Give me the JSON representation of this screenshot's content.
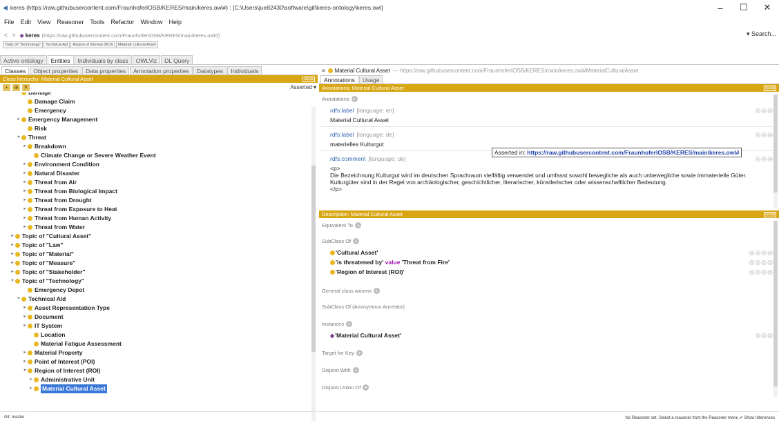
{
  "window": {
    "title": "keres (https://raw.githubusercontent.com/FraunhoferIOSB/KERES/main/keres.owl#) : [C:\\Users\\jue82430\\software\\git\\keres-ontology\\keres.owl]",
    "minimize": "–",
    "maximize": "☐",
    "close": "✕"
  },
  "menu": [
    "File",
    "Edit",
    "View",
    "Reasoner",
    "Tools",
    "Refactor",
    "Window",
    "Help"
  ],
  "address": {
    "back": "<",
    "forward": ">",
    "ontology_name": "keres",
    "ontology_iri": "(https://raw.githubusercontent.com/FraunhoferIOSB/KERES/main/keres.owl#)",
    "search": "Search..."
  },
  "breadcrumbs": [
    "Topic of \"Technology\"",
    "Technical Aid",
    "Region of Interest (ROI)",
    "Material Cultural Asset"
  ],
  "top_tabs": [
    {
      "label": "Active ontology",
      "active": false
    },
    {
      "label": "Entities",
      "active": true
    },
    {
      "label": "Individuals by class",
      "active": false
    },
    {
      "label": "OWLViz",
      "active": false
    },
    {
      "label": "DL Query",
      "active": false
    }
  ],
  "left_tabs": [
    {
      "label": "Classes",
      "active": true
    },
    {
      "label": "Object properties",
      "active": false
    },
    {
      "label": "Data properties",
      "active": false
    },
    {
      "label": "Annotation properties",
      "active": false
    },
    {
      "label": "Datatypes",
      "active": false
    },
    {
      "label": "Individuals",
      "active": false
    }
  ],
  "class_hierarchy": {
    "header": "Class hierarchy: Material Cultural Asset",
    "controls": "⊞⊟⊠",
    "view_mode": "Asserted ▾",
    "tools": [
      "+",
      "⊕",
      "✕"
    ]
  },
  "tree": [
    {
      "label": "Damage",
      "indent": 1,
      "toggle": "▾"
    },
    {
      "label": "Damage Claim",
      "indent": 2,
      "toggle": ""
    },
    {
      "label": "Emergency",
      "indent": 2,
      "toggle": ""
    },
    {
      "label": "Emergency Management",
      "indent": 1,
      "toggle": "▸"
    },
    {
      "label": "Risk",
      "indent": 2,
      "toggle": ""
    },
    {
      "label": "Threat",
      "indent": 1,
      "toggle": "▾"
    },
    {
      "label": "Breakdown",
      "indent": 2,
      "toggle": "▸"
    },
    {
      "label": "Climate Change or Severe Weather Event",
      "indent": 3,
      "toggle": ""
    },
    {
      "label": "Environment Condition",
      "indent": 2,
      "toggle": "▸"
    },
    {
      "label": "Natural Disaster",
      "indent": 2,
      "toggle": "▸"
    },
    {
      "label": "Threat from Air",
      "indent": 2,
      "toggle": "▸"
    },
    {
      "label": "Threat from Biological Impact",
      "indent": 2,
      "toggle": "▸"
    },
    {
      "label": "Threat from Drought",
      "indent": 2,
      "toggle": "▸"
    },
    {
      "label": "Threat from Exposure to Heat",
      "indent": 2,
      "toggle": "▸"
    },
    {
      "label": "Threat from Human Activity",
      "indent": 2,
      "toggle": "▸"
    },
    {
      "label": "Threat from Water",
      "indent": 2,
      "toggle": "▸"
    },
    {
      "label": "Topic of \"Cultural Asset\"",
      "indent": 0,
      "toggle": "▸"
    },
    {
      "label": "Topic of \"Law\"",
      "indent": 0,
      "toggle": "▸"
    },
    {
      "label": "Topic of \"Material\"",
      "indent": 0,
      "toggle": "▸"
    },
    {
      "label": "Topic of \"Measure\"",
      "indent": 0,
      "toggle": "▸"
    },
    {
      "label": "Topic of \"Stakeholder\"",
      "indent": 0,
      "toggle": "▸"
    },
    {
      "label": "Topic of \"Technology\"",
      "indent": 0,
      "toggle": "▾"
    },
    {
      "label": "Emergency Depot",
      "indent": 2,
      "toggle": ""
    },
    {
      "label": "Technical Aid",
      "indent": 1,
      "toggle": "▾"
    },
    {
      "label": "Asset Representation Type",
      "indent": 2,
      "toggle": "▸"
    },
    {
      "label": "Document",
      "indent": 2,
      "toggle": "▸"
    },
    {
      "label": "IT System",
      "indent": 2,
      "toggle": "▸"
    },
    {
      "label": "Location",
      "indent": 3,
      "toggle": ""
    },
    {
      "label": "Material Fatigue Assessment",
      "indent": 3,
      "toggle": ""
    },
    {
      "label": "Material Property",
      "indent": 2,
      "toggle": "▸"
    },
    {
      "label": "Point of Interest (POI)",
      "indent": 2,
      "toggle": "▸"
    },
    {
      "label": "Region of Interest (ROI)",
      "indent": 2,
      "toggle": "▾"
    },
    {
      "label": "Administrative Unit",
      "indent": 3,
      "toggle": "▸"
    },
    {
      "label": "Material Cultural Asset",
      "indent": 3,
      "toggle": "▸",
      "selected": true
    }
  ],
  "right_title": {
    "menu_icon": "≡",
    "class_name": "Material Cultural Asset",
    "class_iri": "— https://raw.githubusercontent.com/FraunhoferIOSB/KERES/main/keres.owl#MaterialCulturalAsset"
  },
  "right_tabs": [
    {
      "label": "Annotations",
      "active": true
    },
    {
      "label": "Usage",
      "active": false
    }
  ],
  "annotations": {
    "header": "Annotations: Material Cultural Asset",
    "section_label": "Annotations",
    "items": [
      {
        "property": "rdfs:label",
        "lang": "[language: en]",
        "value": "Material Cultural Asset"
      },
      {
        "property": "rdfs:label",
        "lang": "[language: de]",
        "value": "materielles Kulturgut"
      },
      {
        "property": "rdfs:comment",
        "lang": "[language: de]",
        "value": "<p>",
        "value2": "Die Bezeichnung Kulturgut wird im deutschen Sprachraum vielfältig verwendet und umfasst sowohl bewegliche als auch unbewegliche sowie immaterielle Güter. Kulturgüter sind in der Regel von archäologischer, geschichtlicher, literarischer, künstlerischer oder wissenschaftlicher Bedeutung.",
        "value3": "</p>"
      }
    ],
    "row_controls": "◎◎◎",
    "tooltip_prefix": "Asserted in:",
    "tooltip_iri": "https://raw.githubusercontent.com/FraunhoferIOSB/KERES/main/keres.owl#"
  },
  "description": {
    "header": "Description: Material Cultural Asset",
    "equivalent_to": "Equivalent To",
    "subclass_of": "SubClass Of",
    "subclasses": [
      {
        "text": "'Cultural Asset'"
      },
      {
        "text": "'is threatened by'",
        "keyword": "value",
        "rest": "'Threat from Fire'"
      },
      {
        "text": "'Region of Interest (ROI)'"
      }
    ],
    "subclass_controls": "◎◎◎◎",
    "general_axioms": "General class axioms",
    "subclass_anon": "SubClass Of (Anonymous Ancestor)",
    "instances": "Instances",
    "instance": "'Material Cultural Asset'",
    "instance_controls": "◎◎◎",
    "target_for_key": "Target for Key",
    "disjoint_with": "Disjoint With",
    "disjoint_union": "Disjoint Union Of"
  },
  "status": {
    "left": "Git: master",
    "right": "No Reasoner set. Select a reasoner from the Reasoner menu   ✔ Show Inferences"
  }
}
